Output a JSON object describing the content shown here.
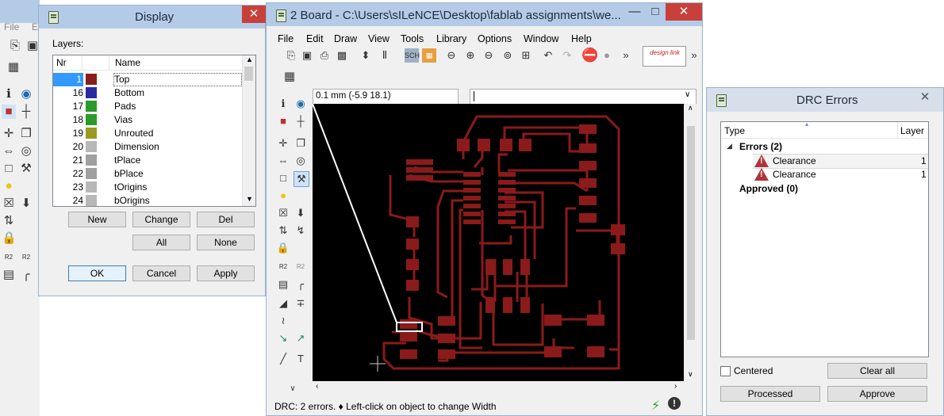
{
  "left_window": {
    "menu": [
      "File",
      "E"
    ]
  },
  "display_dialog": {
    "title": "Display",
    "layers_label": "Layers:",
    "columns": {
      "nr": "Nr",
      "name": "Name"
    },
    "layers": [
      {
        "nr": "1",
        "name": "Top",
        "color": "#8b1c1c",
        "selected": true
      },
      {
        "nr": "16",
        "name": "Bottom",
        "color": "#2a2aa0"
      },
      {
        "nr": "17",
        "name": "Pads",
        "color": "#2a9a2a"
      },
      {
        "nr": "18",
        "name": "Vias",
        "color": "#2a9a2a"
      },
      {
        "nr": "19",
        "name": "Unrouted",
        "color": "#9a9a20"
      },
      {
        "nr": "20",
        "name": "Dimension",
        "color": "#b8b8b8"
      },
      {
        "nr": "21",
        "name": "tPlace",
        "color": "#a0a0a0"
      },
      {
        "nr": "22",
        "name": "bPlace",
        "color": "#a0a0a0"
      },
      {
        "nr": "23",
        "name": "tOrigins",
        "color": "#b8b8b8"
      },
      {
        "nr": "24",
        "name": "bOrigins",
        "color": "#b8b8b8"
      }
    ],
    "buttons": {
      "new": "New",
      "change": "Change",
      "del": "Del",
      "all": "All",
      "none": "None",
      "ok": "OK",
      "cancel": "Cancel",
      "apply": "Apply"
    }
  },
  "board_window": {
    "title": "2 Board - C:\\Users\\sILeNCE\\Desktop\\fablab assignments\\we...",
    "menu": {
      "file": "File",
      "edit": "Edit",
      "draw": "Draw",
      "view": "View",
      "tools": "Tools",
      "library": "Library",
      "options": "Options",
      "window": "Window",
      "help": "Help"
    },
    "coord_readout": "0.1 mm (-5.9 18.1)",
    "command_value": "",
    "status_text": "DRC: 2 errors. ♦ Left-click on object to change Width",
    "logo_text": "design link",
    "trace_color": "#8b1a1a",
    "canvas_color": "#000000"
  },
  "drc_window": {
    "title": "DRC Errors",
    "columns": {
      "type": "Type",
      "layer": "Layer"
    },
    "errors_group": "Errors (2)",
    "errors": [
      {
        "type": "Clearance",
        "layer": "1"
      },
      {
        "type": "Clearance",
        "layer": "1"
      }
    ],
    "approved_group": "Approved (0)",
    "centered_label": "Centered",
    "buttons": {
      "clear_all": "Clear all",
      "processed": "Processed",
      "approve": "Approve"
    }
  }
}
